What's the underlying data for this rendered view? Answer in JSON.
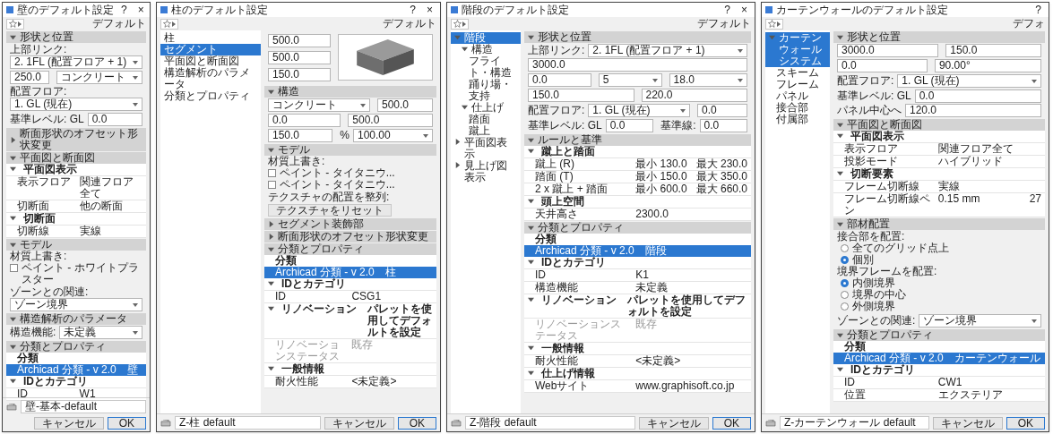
{
  "dialogs": [
    {
      "title": "壁のデフォルト設定",
      "help": "?",
      "close": "×",
      "default_label": "デフォルト",
      "sections": [
        {
          "title": "形状と位置",
          "expanded": true,
          "rows": [
            {
              "kind": "fields",
              "items": [
                {
                  "label": "上部リンク:",
                  "value": "2. 1FL (配置フロア + 1)",
                  "dropdown": true
                }
              ]
            },
            {
              "kind": "fields",
              "items": [
                {
                  "value": "250.0",
                  "dropdown": false
                },
                {
                  "value": "コンクリート",
                  "dropdown": true
                }
              ]
            },
            {
              "kind": "fields",
              "items": [
                {
                  "label": "配置フロア:",
                  "value": "1. GL (現在)",
                  "dropdown": true
                }
              ]
            },
            {
              "kind": "fields",
              "items": [
                {
                  "label": "基準レベル: GL",
                  "value": "0.0",
                  "dropdown": false
                }
              ]
            }
          ]
        },
        {
          "title": "断面形状のオフセット形状変更",
          "expanded": false
        },
        {
          "title": "平面図と断面図",
          "expanded": true,
          "rows": [
            {
              "kind": "group",
              "name": "平面図表示",
              "expanded": true
            },
            {
              "kind": "prop",
              "name": "表示フロア",
              "value": "関連フロア全て",
              "disabled": false
            },
            {
              "kind": "prop",
              "name": "切断面",
              "value": "他の断面",
              "disabled": false
            },
            {
              "kind": "group",
              "name": "切断面",
              "expanded": true
            },
            {
              "kind": "prop",
              "name": "切断線",
              "value": "実線",
              "disabled": false
            }
          ]
        },
        {
          "title": "モデル",
          "expanded": true,
          "rows": [
            {
              "kind": "label",
              "text": "材質上書き:"
            },
            {
              "kind": "check",
              "label": "ペイント - ホワイトプラスター",
              "checked": false
            },
            {
              "kind": "fields",
              "items": [
                {
                  "label": "ゾーンとの関連:",
                  "value": "ゾーン境界",
                  "dropdown": true
                }
              ]
            }
          ]
        },
        {
          "title": "構造解析のパラメータ",
          "expanded": true,
          "rows": [
            {
              "kind": "fields",
              "items": [
                {
                  "label": "構造機能:",
                  "value": "未定義",
                  "dropdown": true
                }
              ]
            }
          ]
        },
        {
          "title": "分類とプロパティ",
          "expanded": true,
          "rows": [
            {
              "kind": "header",
              "text": "分類"
            },
            {
              "kind": "classification",
              "name": "Archicad 分類 - v 2.0",
              "value": "壁",
              "selected": true
            },
            {
              "kind": "group",
              "name": "IDとカテゴリ",
              "expanded": true
            },
            {
              "kind": "prop",
              "name": "ID",
              "value": "W1",
              "disabled": false
            }
          ]
        }
      ],
      "footer": {
        "favorite": "壁-基本-default",
        "cancel": "キャンセル",
        "ok": "OK"
      }
    },
    {
      "title": "柱のデフォルト設定",
      "help": "?",
      "close": "×",
      "default_label": "デフォルト",
      "nav": [
        {
          "label": "柱",
          "selected": false
        },
        {
          "label": "セグメント",
          "selected": true
        },
        {
          "label": "平面図と断面図",
          "selected": false
        },
        {
          "label": "構造解析のパラメータ",
          "selected": false
        },
        {
          "label": "分類とプロパティ",
          "selected": false
        }
      ],
      "top": [
        {
          "kind": "preview",
          "items": [
            {
              "value": "500.0",
              "dropdown": false
            },
            {
              "value": "500.0",
              "dropdown": false
            },
            {
              "value": "150.0",
              "dropdown": false
            }
          ]
        }
      ],
      "sections": [
        {
          "title": "構造",
          "expanded": true,
          "rows": [
            {
              "kind": "fields",
              "items": [
                {
                  "value": "コンクリート",
                  "dropdown": true
                },
                {
                  "value": "500.0",
                  "dropdown": false
                }
              ]
            },
            {
              "kind": "fields",
              "items": [
                {
                  "value": "0.0",
                  "dropdown": false
                },
                {
                  "value": "500.0",
                  "dropdown": false
                }
              ]
            },
            {
              "kind": "fields",
              "items": [
                {
                  "value": "150.0",
                  "dropdown": false
                },
                {
                  "label": "%",
                  "value": "100.00",
                  "dropdown": true
                }
              ]
            }
          ]
        },
        {
          "title": "モデル",
          "expanded": true,
          "rows": [
            {
              "kind": "label",
              "text": "材質上書き:"
            },
            {
              "kind": "check",
              "label": "ペイント - タイタニウ...",
              "checked": false
            },
            {
              "kind": "check",
              "label": "ペイント - タイタニウ...",
              "checked": false
            },
            {
              "kind": "button",
              "label": "テクスチャの配置を整列:",
              "text": "テクスチャをリセット"
            }
          ]
        },
        {
          "title": "セグメント装飾部",
          "expanded": false
        },
        {
          "title": "断面形状のオフセット形状変更",
          "expanded": false
        },
        {
          "title": "分類とプロパティ",
          "expanded": true,
          "rows": [
            {
              "kind": "header",
              "text": "分類"
            },
            {
              "kind": "classification",
              "name": "Archicad 分類 - v 2.0",
              "value": "柱",
              "selected": true
            },
            {
              "kind": "group",
              "name": "IDとカテゴリ",
              "expanded": true
            },
            {
              "kind": "prop",
              "name": "ID",
              "value": "CSG1",
              "disabled": false
            },
            {
              "kind": "group",
              "name": "リノベーション",
              "value": "パレットを使用してデフォルトを設定",
              "expanded": true
            },
            {
              "kind": "prop",
              "name": "リノベーションステータス",
              "value": "既存",
              "disabled": true
            },
            {
              "kind": "group",
              "name": "一般情報",
              "expanded": true
            },
            {
              "kind": "prop",
              "name": "耐火性能",
              "value": "<未定義>",
              "disabled": false
            }
          ]
        }
      ],
      "footer": {
        "favorite": "Z-柱 default",
        "cancel": "キャンセル",
        "ok": "OK"
      }
    },
    {
      "title": "階段のデフォルト設定",
      "help": "?",
      "close": "×",
      "default_label": "デフォルト",
      "nav": [
        {
          "label": "階段",
          "selected": true,
          "expanded": true,
          "children": [
            {
              "label": "構造",
              "selected": false,
              "expanded": true,
              "children": [
                {
                  "label": "フライト・構造",
                  "selected": false
                },
                {
                  "label": "踊り場・支持",
                  "selected": false
                }
              ]
            },
            {
              "label": "仕上げ",
              "selected": false,
              "expanded": true,
              "children": [
                {
                  "label": "踏面",
                  "selected": false
                },
                {
                  "label": "蹴上",
                  "selected": false
                }
              ]
            }
          ]
        },
        {
          "label": "平面図表示",
          "selected": false,
          "expanded": false
        },
        {
          "label": "見上げ図表示",
          "selected": false,
          "expanded": false
        }
      ],
      "sections": [
        {
          "title": "形状と位置",
          "expanded": true,
          "rows": [
            {
              "kind": "fields",
              "items": [
                {
                  "label": "上部リンク:",
                  "value": "2. 1FL (配置フロア + 1)",
                  "dropdown": true
                },
                {
                  "value": "3000.0",
                  "dropdown": false
                }
              ]
            },
            {
              "kind": "fields",
              "items": [
                {
                  "value": "0.0",
                  "dropdown": false
                },
                {
                  "value": "5",
                  "dropdown": true
                },
                {
                  "value": "18.0",
                  "dropdown": true
                }
              ]
            },
            {
              "kind": "fields",
              "items": [
                {
                  "value": "150.0",
                  "dropdown": false
                },
                {
                  "value": "220.0",
                  "dropdown": false
                }
              ]
            },
            {
              "kind": "fields",
              "items": [
                {
                  "label": "配置フロア:",
                  "value": "1. GL (現在)",
                  "dropdown": true
                },
                {
                  "value": "0.0",
                  "dropdown": false
                }
              ]
            },
            {
              "kind": "fields",
              "items": [
                {
                  "label": "基準レベル: GL",
                  "value": "0.0",
                  "dropdown": false
                },
                {
                  "label": "基準線:",
                  "value": "0.0",
                  "dropdown": false
                }
              ]
            }
          ]
        },
        {
          "title": "ルールと基準",
          "expanded": true,
          "rows": [
            {
              "kind": "group",
              "name": "蹴上と踏面",
              "expanded": true
            },
            {
              "kind": "prop",
              "name": "蹴上 (R)",
              "value": "最小 130.0",
              "extra": "最大 230.0",
              "disabled": false
            },
            {
              "kind": "prop",
              "name": "踏面 (T)",
              "value": "最小 150.0",
              "extra": "最大 350.0",
              "disabled": false
            },
            {
              "kind": "prop",
              "name": "2 x 蹴上 + 踏面",
              "value": "最小 600.0",
              "extra": "最大 660.0",
              "disabled": false
            },
            {
              "kind": "group",
              "name": "頭上空間",
              "expanded": true
            },
            {
              "kind": "prop",
              "name": "天井高さ",
              "value": "2300.0",
              "disabled": false
            }
          ]
        },
        {
          "title": "分類とプロパティ",
          "expanded": true,
          "rows": [
            {
              "kind": "header",
              "text": "分類"
            },
            {
              "kind": "classification",
              "name": "Archicad 分類 - v 2.0",
              "value": "階段",
              "selected": true
            },
            {
              "kind": "group",
              "name": "IDとカテゴリ",
              "expanded": true
            },
            {
              "kind": "prop",
              "name": "ID",
              "value": "K1",
              "disabled": false
            },
            {
              "kind": "prop",
              "name": "構造機能",
              "value": "未定義",
              "disabled": false
            },
            {
              "kind": "group",
              "name": "リノベーション",
              "value": "パレットを使用してデフォルトを設定",
              "expanded": true
            },
            {
              "kind": "prop",
              "name": "リノベーションステータス",
              "value": "既存",
              "disabled": true
            },
            {
              "kind": "group",
              "name": "一般情報",
              "expanded": true
            },
            {
              "kind": "prop",
              "name": "耐火性能",
              "value": "<未定義>",
              "disabled": false
            },
            {
              "kind": "group",
              "name": "仕上げ情報",
              "expanded": true
            },
            {
              "kind": "prop",
              "name": "Webサイト",
              "value": "www.graphisoft.co.jp",
              "disabled": false
            }
          ]
        }
      ],
      "footer": {
        "favorite": "Z-階段 default",
        "cancel": "キャンセル",
        "ok": "OK"
      }
    },
    {
      "title": "カーテンウォールのデフォルト設定",
      "help": "?",
      "default_label": "デフォ",
      "nav": [
        {
          "label": "カーテンウォールシステム",
          "selected": true,
          "expanded": true,
          "children": [
            {
              "label": "スキーム",
              "selected": false
            },
            {
              "label": "フレーム",
              "selected": false
            },
            {
              "label": "パネル",
              "selected": false
            },
            {
              "label": "接合部",
              "selected": false
            },
            {
              "label": "付属部",
              "selected": false
            }
          ]
        }
      ],
      "sections": [
        {
          "title": "形状と位置",
          "expanded": true,
          "rows": [
            {
              "kind": "fields",
              "items": [
                {
                  "value": "3000.0",
                  "dropdown": false
                },
                {
                  "value": "150.0",
                  "dropdown": false
                }
              ]
            },
            {
              "kind": "fields",
              "items": [
                {
                  "value": "0.0",
                  "dropdown": false
                },
                {
                  "value": "90.00°",
                  "dropdown": false
                }
              ]
            },
            {
              "kind": "fields",
              "items": [
                {
                  "label": "配置フロア:",
                  "value": "1. GL (現在)",
                  "dropdown": true
                }
              ]
            },
            {
              "kind": "fields",
              "items": [
                {
                  "label": "基準レベル: GL",
                  "value": "0.0",
                  "dropdown": false
                },
                {
                  "label": "パネル中心へ",
                  "value": "120.0",
                  "dropdown": false
                }
              ]
            }
          ]
        },
        {
          "title": "平面図と断面図",
          "expanded": true,
          "rows": [
            {
              "kind": "group",
              "name": "平面図表示",
              "expanded": true
            },
            {
              "kind": "prop",
              "name": "表示フロア",
              "value": "関連フロア全て",
              "disabled": false
            },
            {
              "kind": "prop",
              "name": "投影モード",
              "value": "ハイブリッド",
              "disabled": false
            },
            {
              "kind": "group",
              "name": "切断要素",
              "expanded": true
            },
            {
              "kind": "prop",
              "name": "フレーム切断線",
              "value": "実線",
              "disabled": false
            },
            {
              "kind": "prop",
              "name": "フレーム切断線ペン",
              "value": "0.15 mm",
              "extra": "27",
              "disabled": false
            }
          ]
        },
        {
          "title": "部材配置",
          "expanded": true,
          "rows": [
            {
              "kind": "radios",
              "columns": [
                {
                  "heading": "接合部を配置:",
                  "options": [
                    {
                      "label": "全てのグリッド点上",
                      "selected": false
                    },
                    {
                      "label": "個別",
                      "selected": true
                    }
                  ]
                },
                {
                  "heading": "境界フレームを配置:",
                  "options": [
                    {
                      "label": "内側境界",
                      "selected": true
                    },
                    {
                      "label": "境界の中心",
                      "selected": false
                    },
                    {
                      "label": "外側境界",
                      "selected": false
                    }
                  ]
                }
              ]
            },
            {
              "kind": "fields",
              "items": [
                {
                  "label": "ゾーンとの関連:",
                  "value": "ゾーン境界",
                  "dropdown": true
                }
              ]
            }
          ]
        },
        {
          "title": "分類とプロパティ",
          "expanded": true,
          "rows": [
            {
              "kind": "header",
              "text": "分類"
            },
            {
              "kind": "classification",
              "name": "Archicad 分類 - v 2.0",
              "value": "カーテンウォール",
              "selected": true
            },
            {
              "kind": "group",
              "name": "IDとカテゴリ",
              "expanded": true
            },
            {
              "kind": "prop",
              "name": "ID",
              "value": "CW1",
              "disabled": false
            },
            {
              "kind": "prop",
              "name": "位置",
              "value": "エクステリア",
              "disabled": false
            }
          ]
        }
      ],
      "footer": {
        "favorite": "Z-カーテンウォール default",
        "cancel": "キャンセル",
        "ok": "OK"
      }
    }
  ]
}
